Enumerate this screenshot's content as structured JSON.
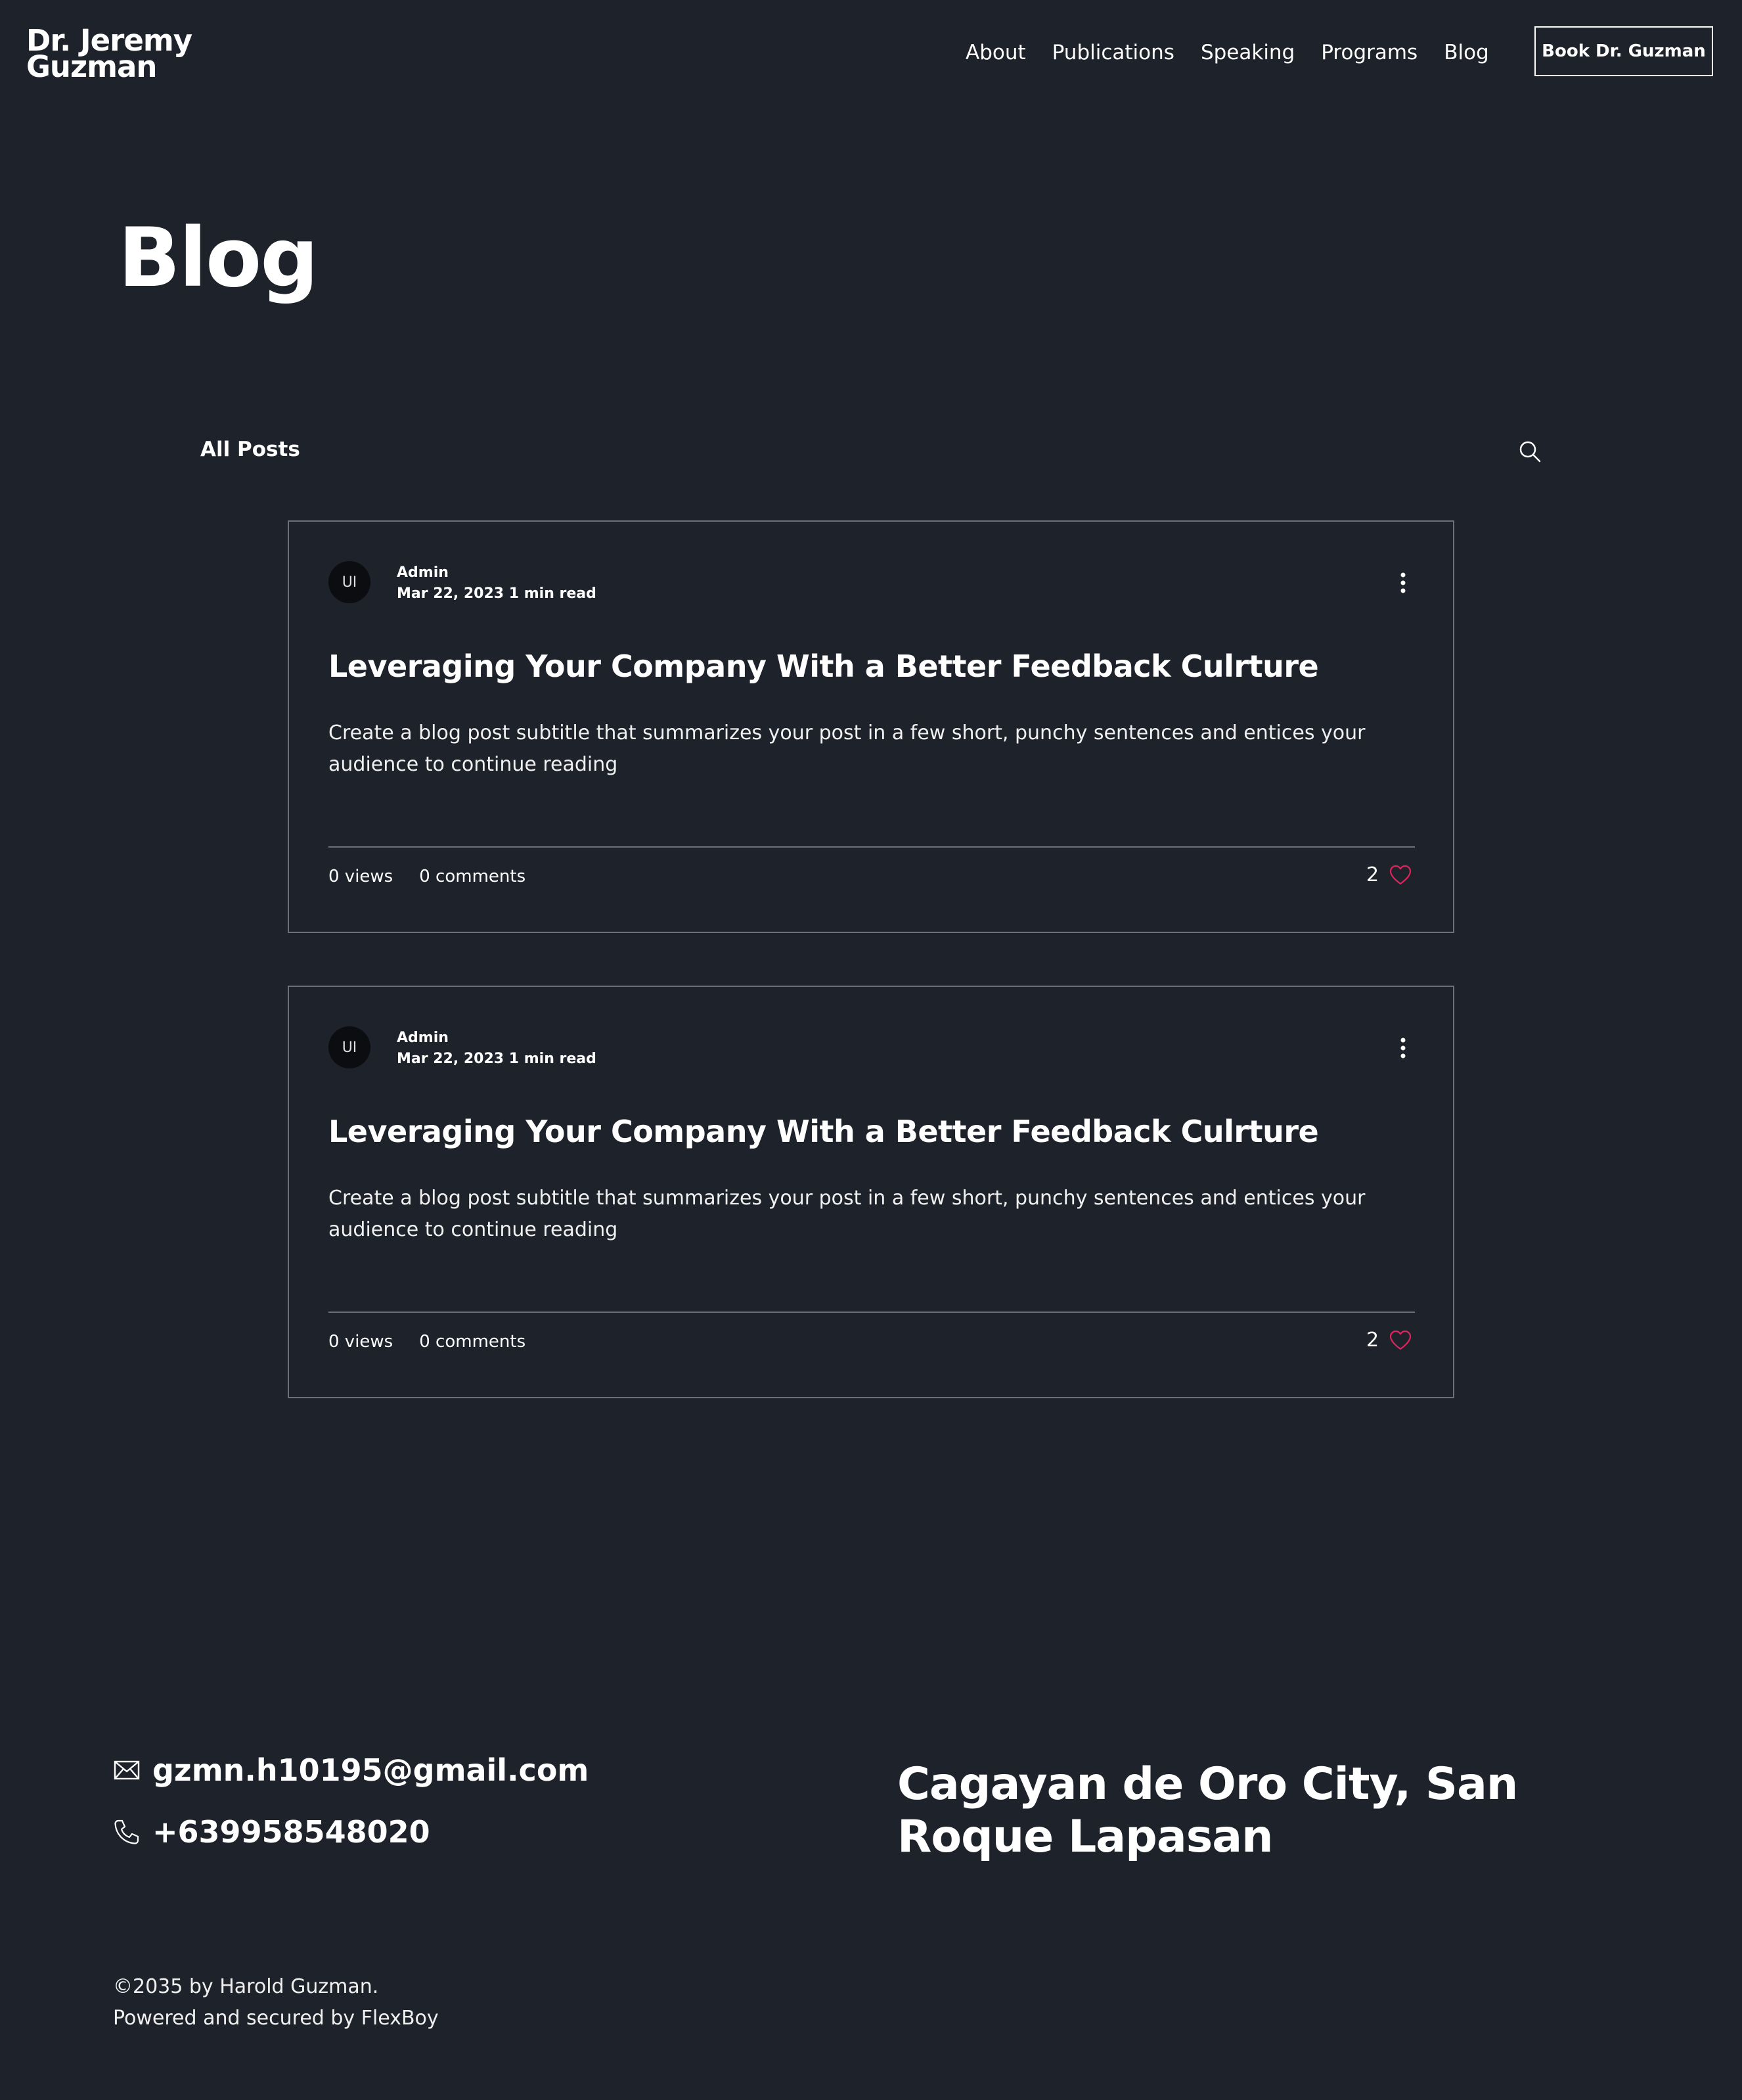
{
  "header": {
    "brand_line1": "Dr. Jeremy",
    "brand_line2": "Guzman",
    "nav": [
      "About",
      "Publications",
      "Speaking",
      "Programs",
      "Blog"
    ],
    "cta_label": "Book Dr. Guzman"
  },
  "page": {
    "title": "Blog"
  },
  "filter": {
    "label": "All Posts",
    "search_icon": "search-icon"
  },
  "posts": [
    {
      "avatar_initials": "UI",
      "author": "Admin",
      "date": "Mar 22, 2023",
      "read_time": "1 min read",
      "title": "Leveraging Your Company With a Better Feedback Culrture",
      "excerpt": "Create a blog post subtitle that summarizes your post in a few short, punchy sentences and entices your audience to continue reading",
      "views": "0 views",
      "comments": "0 comments",
      "likes": "2"
    },
    {
      "avatar_initials": "UI",
      "author": "Admin",
      "date": "Mar 22, 2023",
      "read_time": "1 min read",
      "title": "Leveraging Your Company With a Better Feedback Culrture",
      "excerpt": "Create a blog post subtitle that summarizes your post in a few short, punchy sentences and entices your audience to continue reading",
      "views": "0 views",
      "comments": "0 comments",
      "likes": "2"
    }
  ],
  "footer": {
    "email": "gzmn.h10195@gmail.com",
    "phone": "+639958548020",
    "address": "Cagayan de Oro City, San Roque Lapasan",
    "copyright_line1": "©2035 by Harold Guzman.",
    "copyright_line2": "Powered and secured by FlexBoy"
  },
  "colors": {
    "background": "#1e222b",
    "text": "#ffffff",
    "card_border": "#6b7079",
    "heart": "#e0245e"
  },
  "icons": [
    "search-icon",
    "more-vertical-icon",
    "heart-icon",
    "envelope-icon",
    "phone-icon"
  ]
}
